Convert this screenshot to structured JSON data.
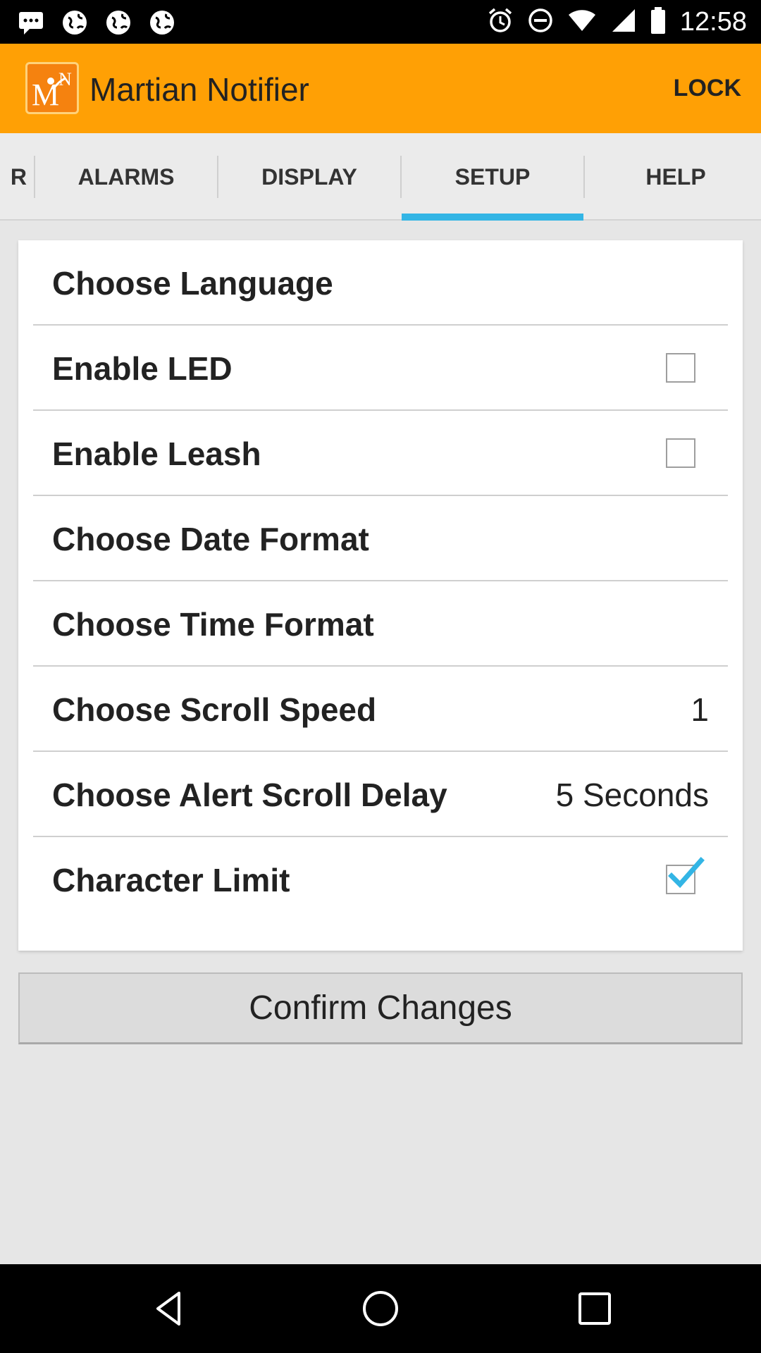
{
  "status_bar": {
    "time": "12:58",
    "icons": [
      "message-icon",
      "globe-icon",
      "globe-icon",
      "globe-icon",
      "alarm-icon",
      "do-not-disturb-icon",
      "wifi-icon",
      "signal-icon",
      "battery-icon"
    ]
  },
  "app_bar": {
    "title": "Martian Notifier",
    "lock_label": "LOCK",
    "logo_letters": "MN",
    "accent_color": "#ffa005"
  },
  "tabs": [
    {
      "label": "R",
      "selected": false
    },
    {
      "label": "ALARMS",
      "selected": false
    },
    {
      "label": "DISPLAY",
      "selected": false
    },
    {
      "label": "SETUP",
      "selected": true
    },
    {
      "label": "HELP",
      "selected": false
    }
  ],
  "tab_indicator_color": "#33b5e5",
  "settings": [
    {
      "label": "Choose Language"
    },
    {
      "label": "Enable LED",
      "checked": false
    },
    {
      "label": "Enable Leash",
      "checked": false
    },
    {
      "label": "Choose Date Format"
    },
    {
      "label": "Choose Time Format"
    },
    {
      "label": "Choose Scroll Speed",
      "value": "1"
    },
    {
      "label": "Choose Alert Scroll Delay",
      "value": "5 Seconds"
    },
    {
      "label": "Character Limit",
      "checked": true
    }
  ],
  "confirm_label": "Confirm Changes",
  "nav": [
    "back-icon",
    "home-icon",
    "recents-icon"
  ]
}
